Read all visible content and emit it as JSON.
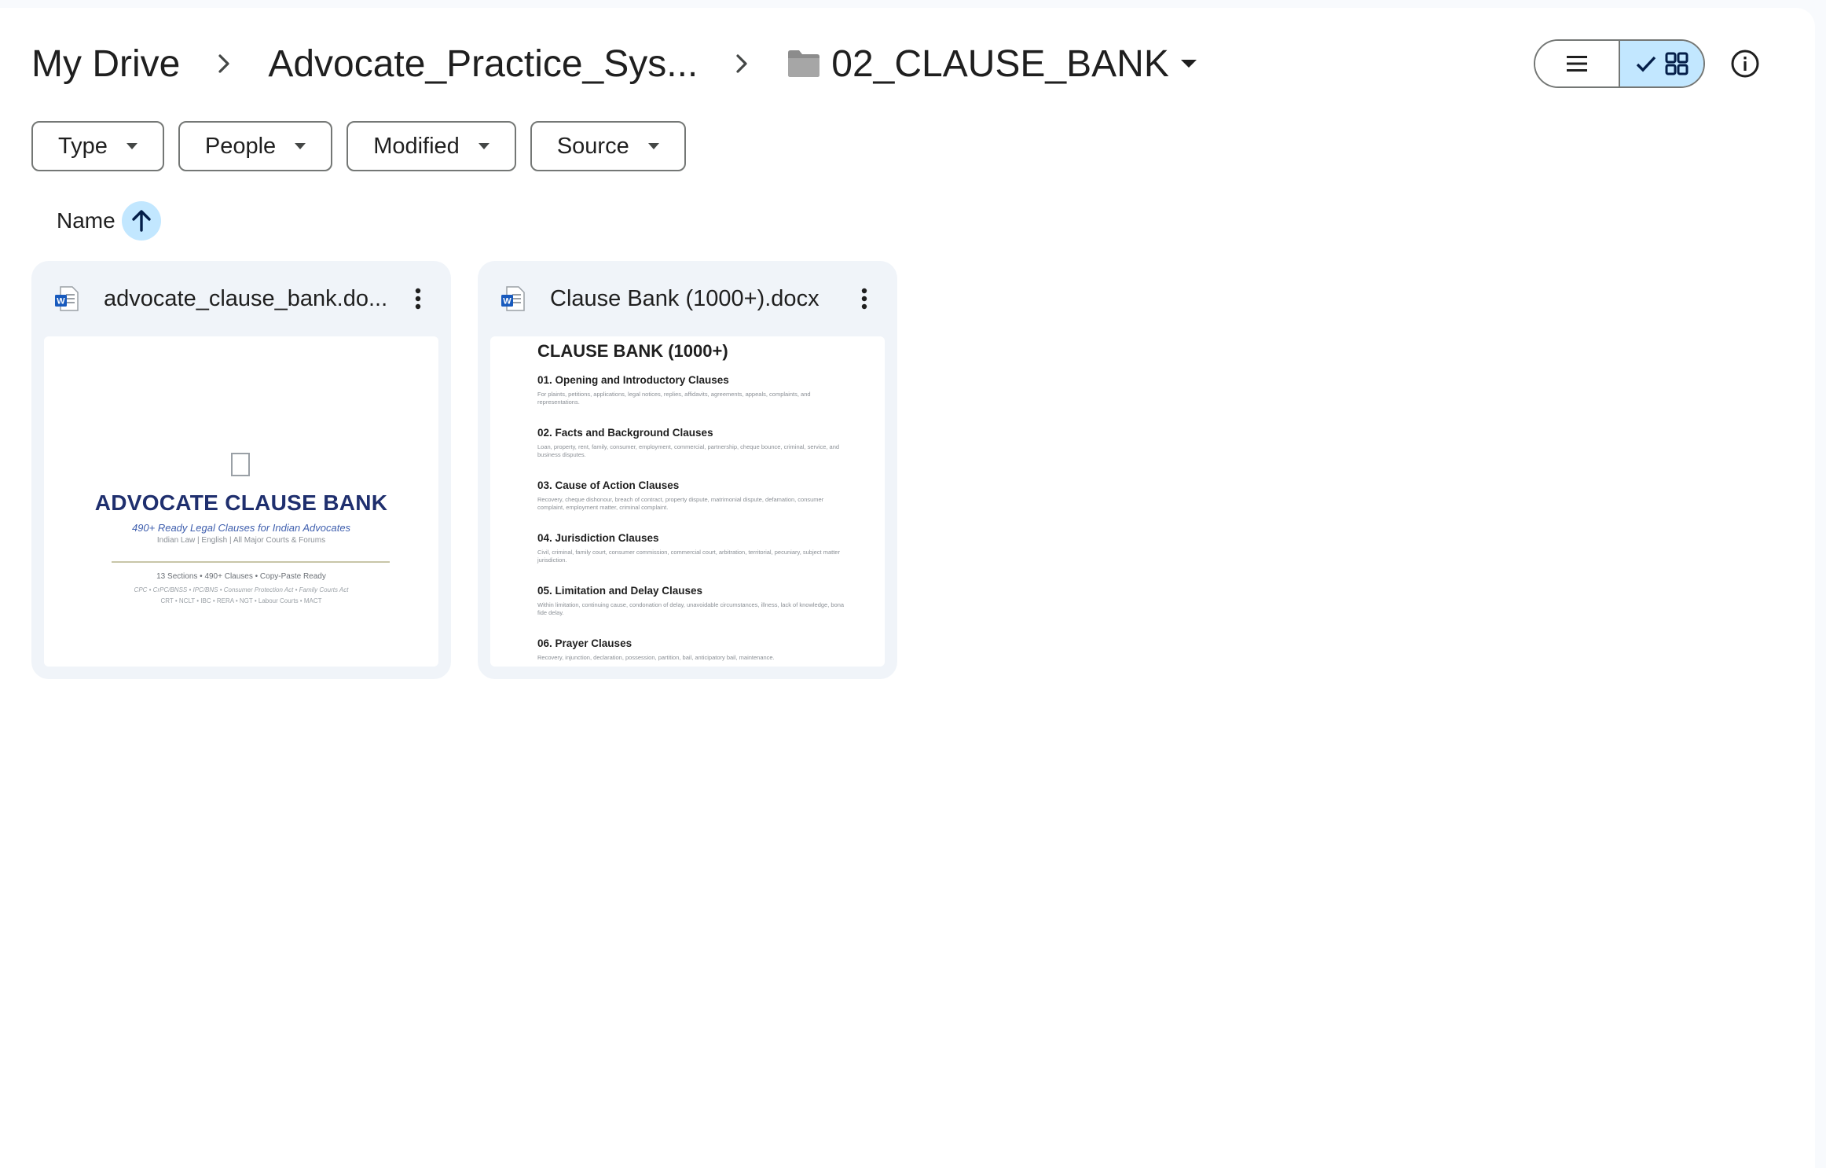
{
  "breadcrumb": {
    "root": "My Drive",
    "parent": "Advocate_Practice_Sys...",
    "current": "02_CLAUSE_BANK"
  },
  "filters": [
    {
      "label": "Type"
    },
    {
      "label": "People"
    },
    {
      "label": "Modified"
    },
    {
      "label": "Source"
    }
  ],
  "sort": {
    "label": "Name",
    "direction": "ascending"
  },
  "view": {
    "mode": "grid"
  },
  "colors": {
    "accent": "#c2e7ff",
    "card": "#f0f4f9",
    "word_blue": "#185abd"
  },
  "files": [
    {
      "name": "advocate_clause_bank.do...",
      "icon": "word-doc-icon",
      "preview": {
        "title": "ADVOCATE CLAUSE BANK",
        "subtitle": "490+ Ready Legal Clauses for Indian Advocates",
        "meta": "Indian Law | English | All Major Courts & Forums",
        "stats": "13 Sections • 490+ Clauses • Copy-Paste Ready",
        "acts": "CPC • CrPC/BNSS • IPC/BNS • Consumer Protection Act • Family Courts Act",
        "acts2": "CRT • NCLT • IBC • RERA • NGT • Labour Courts • MACT"
      }
    },
    {
      "name": "Clause Bank (1000+).docx",
      "icon": "word-doc-icon",
      "preview": {
        "title": "CLAUSE BANK (1000+)",
        "sections": [
          {
            "heading": "01. Opening and Introductory Clauses",
            "body": "For plaints, petitions, applications, legal notices, replies, affidavits, agreements, appeals, complaints, and representations."
          },
          {
            "heading": "02. Facts and Background Clauses",
            "body": "Loan, property, rent, family, consumer, employment, commercial, partnership, cheque bounce, criminal, service, and business disputes."
          },
          {
            "heading": "03. Cause of Action Clauses",
            "body": "Recovery, cheque dishonour, breach of contract, property dispute, matrimonial dispute, defamation, consumer complaint, employment matter, criminal complaint."
          },
          {
            "heading": "04. Jurisdiction Clauses",
            "body": "Civil, criminal, family court, consumer commission, commercial court, arbitration, territorial, pecuniary, subject matter jurisdiction."
          },
          {
            "heading": "05. Limitation and Delay Clauses",
            "body": "Within limitation, continuing cause, condonation of delay, unavoidable circumstances, illness, lack of knowledge, bona fide delay."
          },
          {
            "heading": "06. Prayer Clauses",
            "body": "Recovery, injunction, declaration, possession, partition, bail, anticipatory bail, maintenance."
          }
        ]
      }
    }
  ]
}
